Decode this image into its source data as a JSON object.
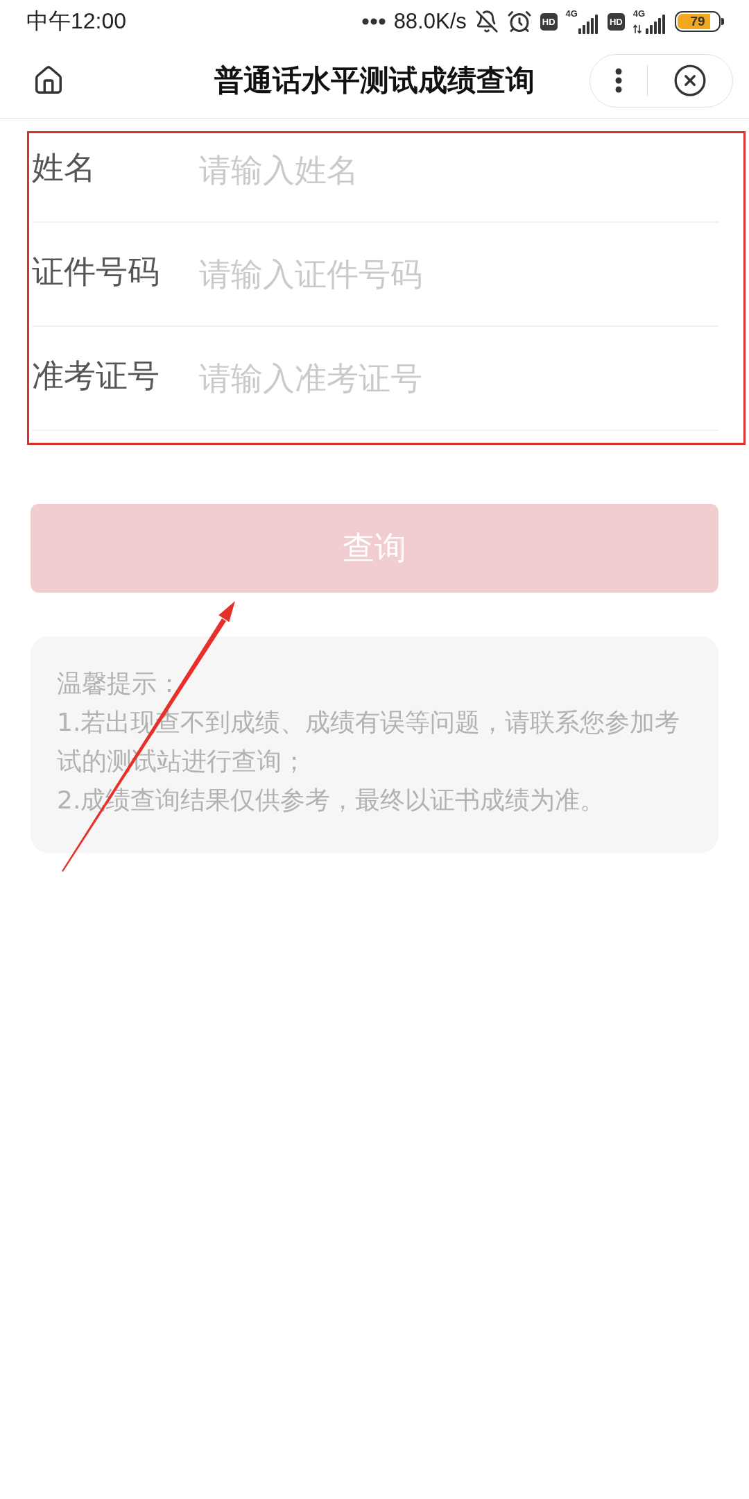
{
  "status_bar": {
    "time": "中午12:00",
    "network_speed": "88.0K/s",
    "sims": [
      {
        "badge": "HD",
        "network": "4G",
        "data_activity": false
      },
      {
        "badge": "HD",
        "network": "4G",
        "data_activity": true
      }
    ],
    "battery": "79"
  },
  "nav_bar": {
    "title": "普通话水平测试成绩查询"
  },
  "form": {
    "fields": [
      {
        "label": "姓名",
        "placeholder": "请输入姓名"
      },
      {
        "label": "证件号码",
        "placeholder": "请输入证件号码"
      },
      {
        "label": "准考证号",
        "placeholder": "请输入准考证号"
      }
    ]
  },
  "submit_button": {
    "label": "查询",
    "disabled": true
  },
  "tips": {
    "title": "温馨提示：",
    "items": [
      "1.若出现查不到成绩、成绩有误等问题，请联系您参加考试的测试站进行查询；",
      "2.成绩查询结果仅供参考，最终以证书成绩为准。"
    ]
  }
}
